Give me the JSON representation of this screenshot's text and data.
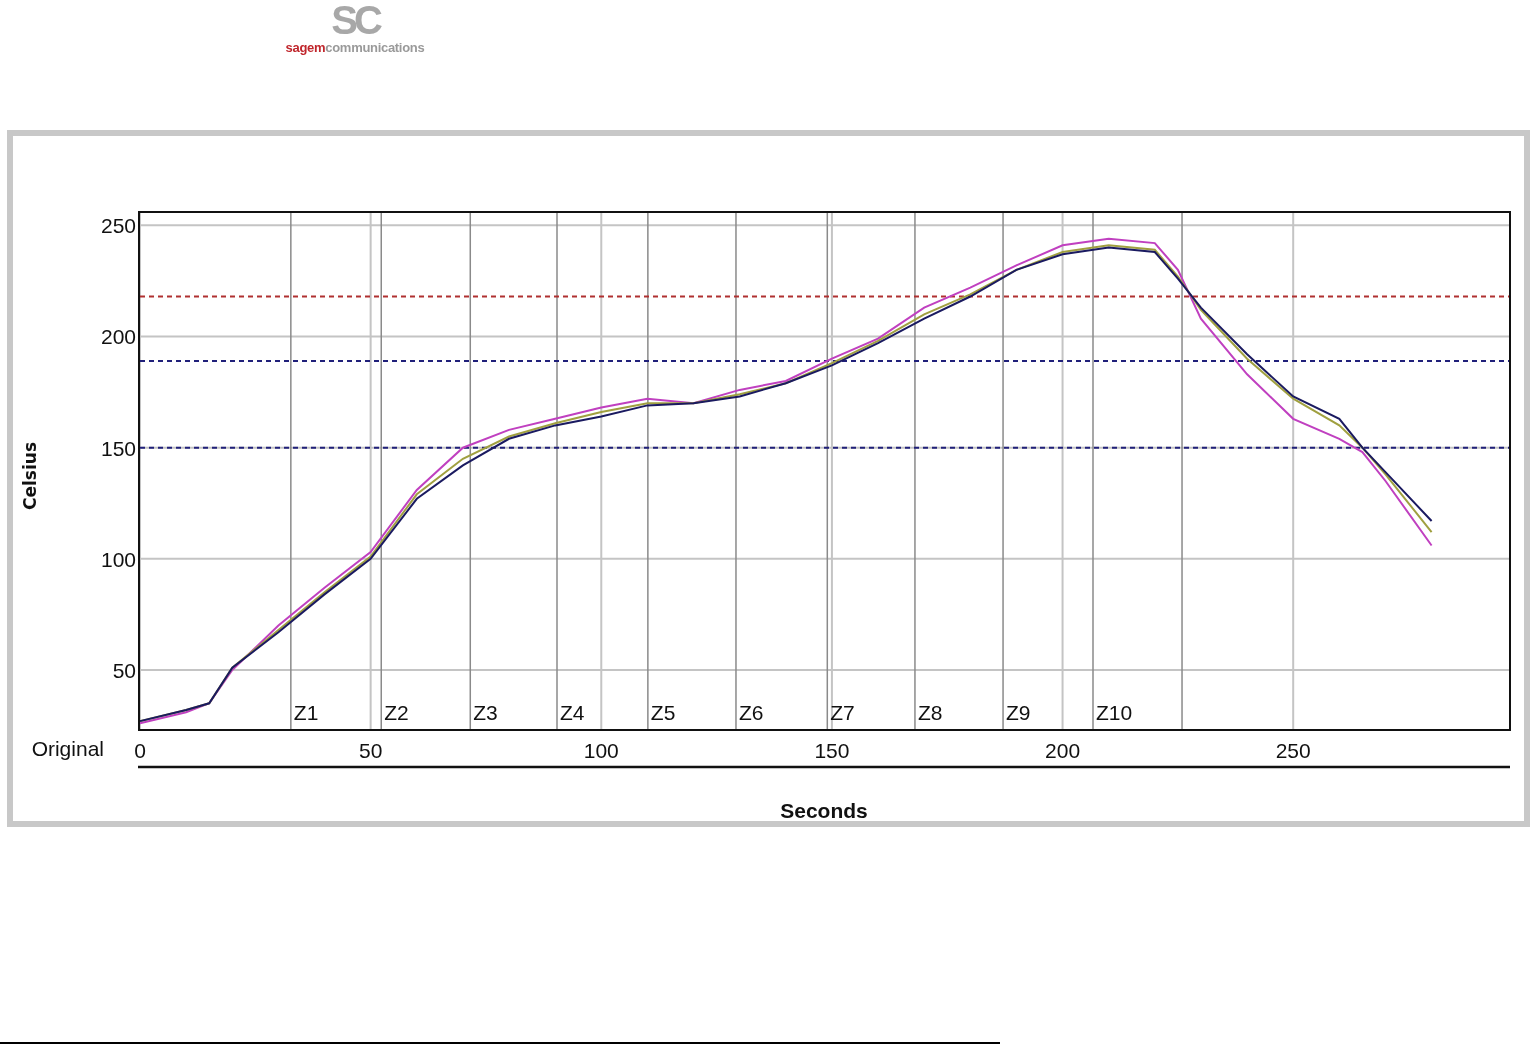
{
  "logo": {
    "monogram": "SC",
    "brand_red": "sagem",
    "brand_gray": "communications"
  },
  "profile_panel": {
    "timeline_label": "Original",
    "chart_data": {
      "type": "line",
      "xlabel": "Seconds",
      "ylabel": "Celsius",
      "xlim": [
        0,
        297
      ],
      "ylim": [
        23,
        256
      ],
      "xticks": [
        0,
        50,
        100,
        150,
        200,
        250
      ],
      "yticks": [
        50,
        100,
        150,
        200,
        250
      ],
      "x": [
        0,
        10,
        15,
        20,
        30,
        40,
        50,
        60,
        70,
        80,
        90,
        100,
        110,
        120,
        130,
        140,
        150,
        160,
        170,
        180,
        190,
        200,
        210,
        220,
        225,
        230,
        240,
        250,
        260,
        265,
        270,
        280
      ],
      "series": [
        {
          "color": "#c040c0",
          "values": [
            26,
            31,
            35,
            50,
            70,
            87,
            103,
            131,
            150,
            158,
            163,
            168,
            172,
            170,
            176,
            180,
            190,
            199,
            213,
            222,
            232,
            241,
            244,
            242,
            230,
            208,
            183,
            163,
            154,
            148,
            135,
            106
          ]
        },
        {
          "color": "#a0a040",
          "values": [
            27,
            32,
            35,
            51,
            68,
            85,
            101,
            129,
            145,
            155,
            161,
            166,
            170,
            170,
            174,
            179,
            188,
            198,
            210,
            219,
            230,
            238,
            241,
            239,
            227,
            212,
            190,
            172,
            160,
            150,
            138,
            112
          ]
        },
        {
          "color": "#1a1a60",
          "values": [
            27,
            32,
            35,
            51,
            67,
            84,
            100,
            127,
            142,
            154,
            160,
            164,
            169,
            170,
            173,
            179,
            187,
            197,
            208,
            218,
            230,
            237,
            240,
            238,
            226,
            213,
            192,
            173,
            163,
            150,
            139,
            117
          ]
        }
      ],
      "grid": true,
      "ref_lines": [
        {
          "axis": "y",
          "value": 218,
          "color": "#b03030"
        },
        {
          "axis": "y",
          "value": 189,
          "color": "#20207a"
        },
        {
          "axis": "y",
          "value": 150,
          "color": "#20207a"
        },
        {
          "axis": "x",
          "value": 32.7,
          "label": "Z1",
          "color": "#8a8a8a"
        },
        {
          "axis": "x",
          "value": 52.3,
          "label": "Z2",
          "color": "#8a8a8a"
        },
        {
          "axis": "x",
          "value": 71.6,
          "label": "Z3",
          "color": "#8a8a8a"
        },
        {
          "axis": "x",
          "value": 90.4,
          "label": "Z4",
          "color": "#8a8a8a"
        },
        {
          "axis": "x",
          "value": 110.1,
          "label": "Z5",
          "color": "#8a8a8a"
        },
        {
          "axis": "x",
          "value": 129.2,
          "label": "Z6",
          "color": "#8a8a8a"
        },
        {
          "axis": "x",
          "value": 149,
          "label": "Z7",
          "color": "#8a8a8a"
        },
        {
          "axis": "x",
          "value": 168,
          "label": "Z8",
          "color": "#8a8a8a"
        },
        {
          "axis": "x",
          "value": 187.1,
          "label": "Z9",
          "color": "#8a8a8a"
        },
        {
          "axis": "x",
          "value": 206.6,
          "label": "Z10",
          "color": "#8a8a8a"
        },
        {
          "axis": "x",
          "value": 225.9,
          "color": "#8a8a8a"
        }
      ]
    }
  }
}
